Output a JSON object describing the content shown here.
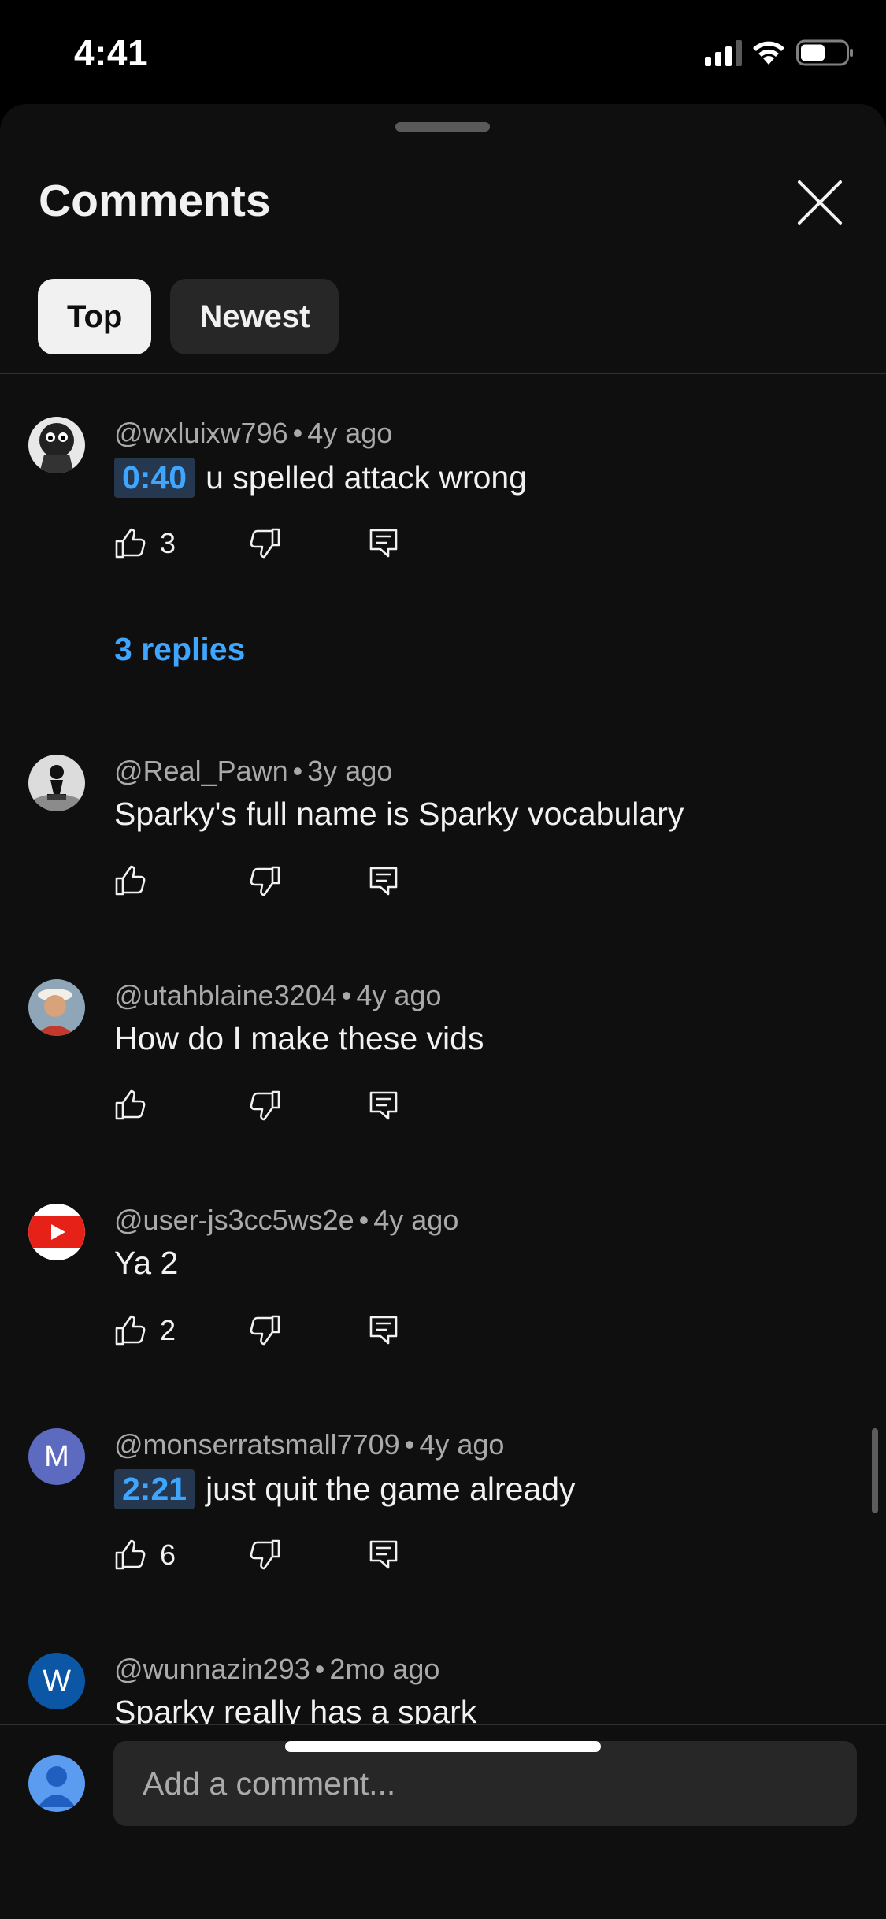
{
  "status_bar": {
    "time": "4:41"
  },
  "sheet": {
    "title": "Comments",
    "tabs": [
      {
        "label": "Top",
        "active": true
      },
      {
        "label": "Newest",
        "active": false
      }
    ]
  },
  "comments": [
    {
      "author": "@wxluixw796",
      "age": "4y ago",
      "timestamp": "0:40",
      "text": "u spelled attack wrong",
      "likes": "3",
      "replies": "3 replies"
    },
    {
      "author": "@Real_Pawn",
      "age": "3y ago",
      "timestamp": "",
      "text": "Sparky's full name is Sparky vocabulary",
      "likes": "",
      "replies": ""
    },
    {
      "author": "@utahblaine3204",
      "age": "4y ago",
      "timestamp": "",
      "text": "How do I make these vids",
      "likes": "",
      "replies": ""
    },
    {
      "author": "@user-js3cc5ws2e",
      "age": "4y ago",
      "timestamp": "",
      "text": "Ya 2",
      "likes": "2",
      "replies": ""
    },
    {
      "author": "@monserratsmall7709",
      "age": "4y ago",
      "timestamp": "2:21",
      "text": "just quit the game already",
      "likes": "6",
      "replies": "",
      "avatar_letter": "M"
    },
    {
      "author": "@wunnazin293",
      "age": "2mo ago",
      "timestamp": "",
      "text": "Sparky really has a spark",
      "likes": "",
      "replies": "",
      "avatar_letter": "W"
    }
  ],
  "dot": "•",
  "composer": {
    "placeholder": "Add a comment..."
  },
  "colors": {
    "accent": "#3ea6ff",
    "sheet_bg": "#0f0f0f",
    "chip_active": "#f1f1f1",
    "chip_inactive": "#272727"
  }
}
